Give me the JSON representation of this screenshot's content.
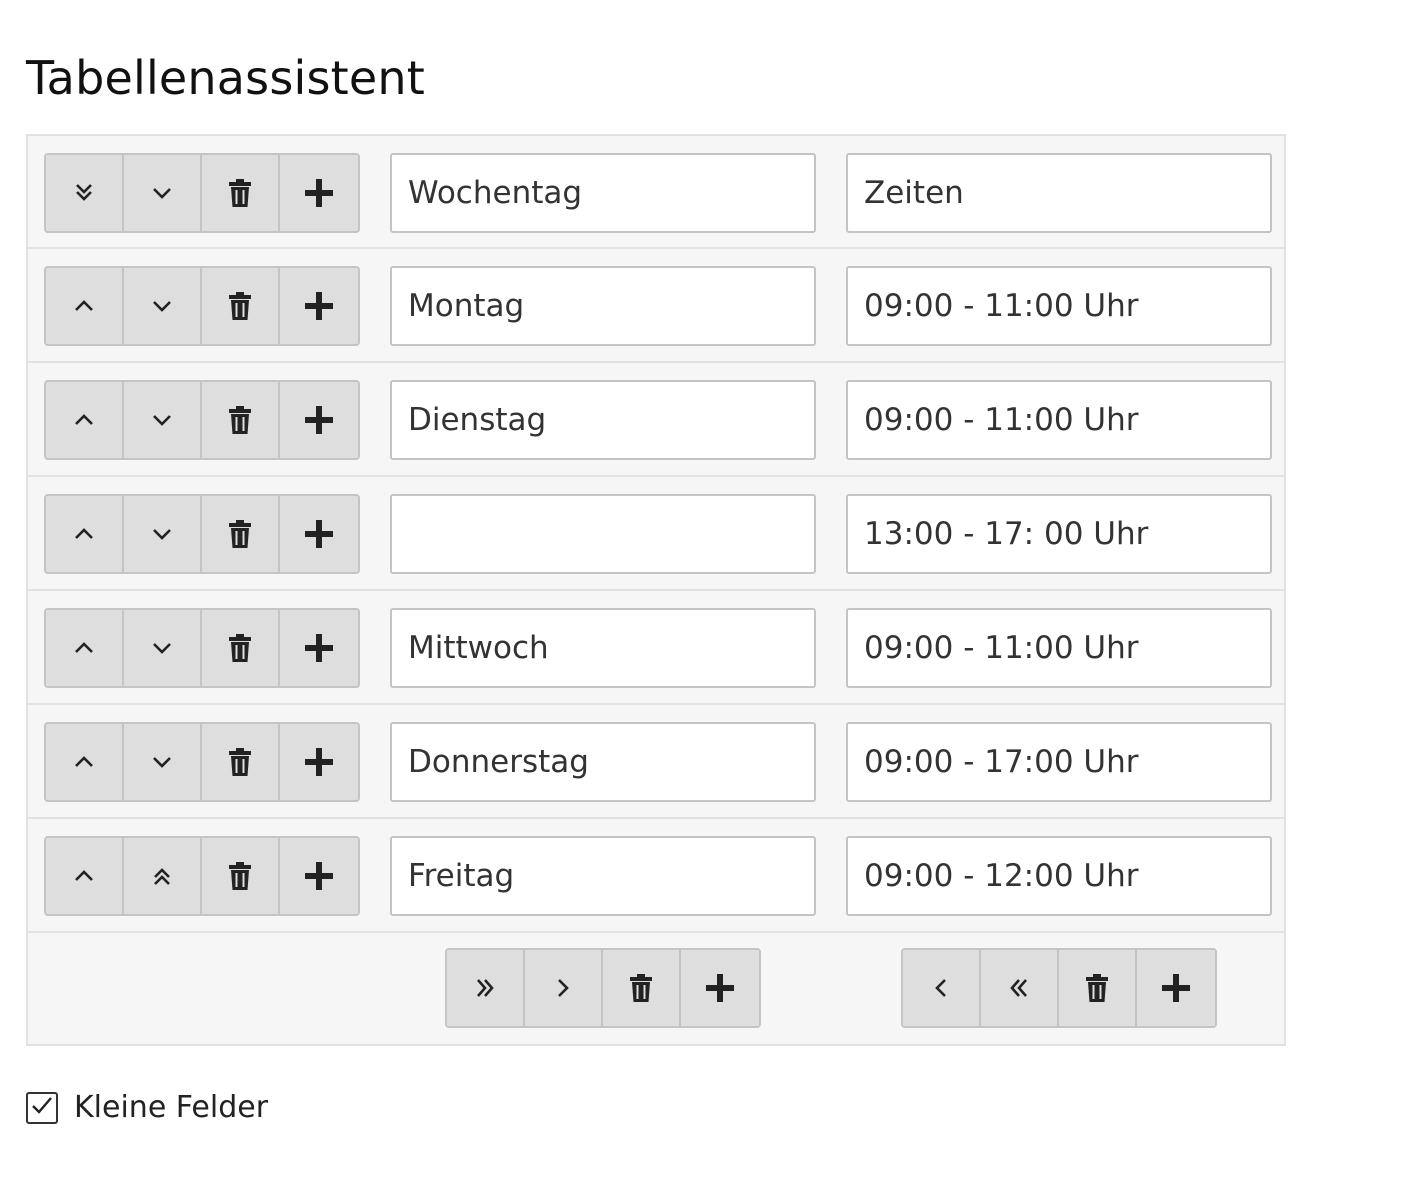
{
  "title": "Tabellenassistent",
  "rows": [
    {
      "up_icon": "double-chevron-down-icon",
      "down_icon": "chevron-down-icon",
      "c1": "Wochentag",
      "c2": "Zeiten"
    },
    {
      "up_icon": "chevron-up-icon",
      "down_icon": "chevron-down-icon",
      "c1": "Montag",
      "c2": "09:00 - 11:00 Uhr"
    },
    {
      "up_icon": "chevron-up-icon",
      "down_icon": "chevron-down-icon",
      "c1": "Dienstag",
      "c2": "09:00 - 11:00 Uhr"
    },
    {
      "up_icon": "chevron-up-icon",
      "down_icon": "chevron-down-icon",
      "c1": "",
      "c2": "13:00 - 17: 00 Uhr"
    },
    {
      "up_icon": "chevron-up-icon",
      "down_icon": "chevron-down-icon",
      "c1": "Mittwoch",
      "c2": "09:00 - 11:00 Uhr"
    },
    {
      "up_icon": "chevron-up-icon",
      "down_icon": "chevron-down-icon",
      "c1": "Donnerstag",
      "c2": "09:00 - 17:00 Uhr"
    },
    {
      "up_icon": "chevron-up-icon",
      "down_icon": "double-chevron-up-icon",
      "c1": "Freitag",
      "c2": "09:00 - 12:00 Uhr"
    }
  ],
  "column_controls": [
    {
      "icons": [
        "double-chevron-right-icon",
        "chevron-right-icon",
        "trash-icon",
        "plus-icon"
      ]
    },
    {
      "icons": [
        "chevron-left-icon",
        "double-chevron-left-icon",
        "trash-icon",
        "plus-icon"
      ]
    }
  ],
  "small_fields": {
    "label": "Kleine Felder",
    "checked": true
  }
}
